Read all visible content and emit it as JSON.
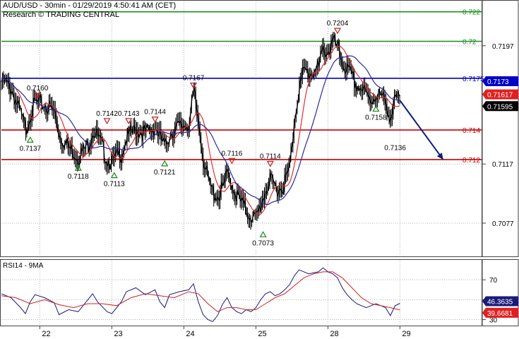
{
  "header": {
    "symbol_line": "AUD/USD - 30min - 01/29/2019 4:50:41 AM (CET)",
    "research_line": "Research © TRADING CENTRAL"
  },
  "chart_data": [
    {
      "type": "candlestick",
      "title": "AUD/USD - 30min - 01/29/2019 4:50:41 AM (CET)",
      "ylim": [
        0.7055,
        0.7227
      ],
      "y_ticks": [
        0.7077,
        0.7117,
        0.7197
      ],
      "x_ticks": [
        {
          "label": "22",
          "t": 0.08
        },
        {
          "label": "23",
          "t": 0.23
        },
        {
          "label": "24",
          "t": 0.38
        },
        {
          "label": "25",
          "t": 0.53
        },
        {
          "label": "28",
          "t": 0.68
        },
        {
          "label": "29",
          "t": 0.83
        }
      ],
      "horizontal_levels": [
        {
          "value": 0.722,
          "label": "0.722",
          "color": "#1e8c1e"
        },
        {
          "value": 0.72,
          "label": "0.72",
          "color": "#1e8c1e"
        },
        {
          "value": 0.7175,
          "label": "0.7175",
          "color": "#0000b4"
        },
        {
          "value": 0.714,
          "label": "0.714",
          "color": "#c80000"
        },
        {
          "value": 0.712,
          "label": "0.712",
          "color": "#c80000"
        }
      ],
      "price_badges": [
        {
          "value": 0.7173,
          "label": "0.7173",
          "color": "#0000c8"
        },
        {
          "value": 0.71617,
          "label": "0.71617",
          "color": "#e02020"
        },
        {
          "value": 0.71595,
          "label": "0.71595",
          "color": "#000000"
        }
      ],
      "close_path": [
        [
          0.0,
          0.7173
        ],
        [
          0.02,
          0.7168
        ],
        [
          0.04,
          0.715
        ],
        [
          0.05,
          0.714
        ],
        [
          0.06,
          0.7152
        ],
        [
          0.07,
          0.7158
        ],
        [
          0.09,
          0.7157
        ],
        [
          0.11,
          0.7152
        ],
        [
          0.12,
          0.7137
        ],
        [
          0.14,
          0.7128
        ],
        [
          0.16,
          0.7122
        ],
        [
          0.18,
          0.713
        ],
        [
          0.19,
          0.714
        ],
        [
          0.2,
          0.7135
        ],
        [
          0.22,
          0.712
        ],
        [
          0.23,
          0.7118
        ],
        [
          0.25,
          0.7125
        ],
        [
          0.26,
          0.7135
        ],
        [
          0.28,
          0.714
        ],
        [
          0.3,
          0.7138
        ],
        [
          0.32,
          0.7142
        ],
        [
          0.33,
          0.7135
        ],
        [
          0.34,
          0.7128
        ],
        [
          0.35,
          0.7138
        ],
        [
          0.37,
          0.7142
        ],
        [
          0.39,
          0.7145
        ],
        [
          0.4,
          0.7165
        ],
        [
          0.41,
          0.7145
        ],
        [
          0.42,
          0.712
        ],
        [
          0.43,
          0.7105
        ],
        [
          0.44,
          0.7098
        ],
        [
          0.45,
          0.7095
        ],
        [
          0.46,
          0.71
        ],
        [
          0.47,
          0.711
        ],
        [
          0.48,
          0.7103
        ],
        [
          0.49,
          0.7095
        ],
        [
          0.5,
          0.709
        ],
        [
          0.51,
          0.7085
        ],
        [
          0.52,
          0.7082
        ],
        [
          0.53,
          0.708
        ],
        [
          0.54,
          0.709
        ],
        [
          0.55,
          0.71
        ],
        [
          0.56,
          0.7105
        ],
        [
          0.57,
          0.7102
        ],
        [
          0.58,
          0.71
        ],
        [
          0.59,
          0.7105
        ],
        [
          0.6,
          0.7115
        ],
        [
          0.61,
          0.715
        ],
        [
          0.62,
          0.717
        ],
        [
          0.63,
          0.718
        ],
        [
          0.64,
          0.7178
        ],
        [
          0.66,
          0.7182
        ],
        [
          0.67,
          0.7195
        ],
        [
          0.68,
          0.7193
        ],
        [
          0.69,
          0.72
        ],
        [
          0.7,
          0.7195
        ],
        [
          0.71,
          0.7185
        ],
        [
          0.72,
          0.718
        ],
        [
          0.73,
          0.7175
        ],
        [
          0.74,
          0.717
        ],
        [
          0.75,
          0.7168
        ],
        [
          0.76,
          0.7162
        ],
        [
          0.77,
          0.716
        ],
        [
          0.78,
          0.7165
        ],
        [
          0.79,
          0.7162
        ],
        [
          0.8,
          0.7158
        ],
        [
          0.81,
          0.7148
        ],
        [
          0.82,
          0.716
        ],
        [
          0.83,
          0.7161
        ]
      ],
      "forecast_arrow": {
        "from": [
          0.83,
          0.716
        ],
        "to": [
          0.92,
          0.712
        ],
        "color": "#0b1f7a"
      },
      "annotations": [
        {
          "label": "0.7160",
          "kind": "high",
          "t": 0.075,
          "v": 0.716
        },
        {
          "label": "0.7142",
          "kind": "high",
          "t": 0.22,
          "v": 0.7143
        },
        {
          "label": "0.7143",
          "kind": "high",
          "t": 0.265,
          "v": 0.7143
        },
        {
          "label": "0.7144",
          "kind": "high",
          "t": 0.32,
          "v": 0.7144
        },
        {
          "label": "0.7167",
          "kind": "high",
          "t": 0.4,
          "v": 0.7167
        },
        {
          "label": "0.7116",
          "kind": "high",
          "t": 0.48,
          "v": 0.7116
        },
        {
          "label": "0.7114",
          "kind": "high",
          "t": 0.56,
          "v": 0.7114
        },
        {
          "label": "0.7204",
          "kind": "high",
          "t": 0.7,
          "v": 0.7204
        },
        {
          "label": "0.7137",
          "kind": "low",
          "t": 0.06,
          "v": 0.7137
        },
        {
          "label": "0.7118",
          "kind": "low",
          "t": 0.16,
          "v": 0.7118
        },
        {
          "label": "0.7113",
          "kind": "low",
          "t": 0.235,
          "v": 0.7113
        },
        {
          "label": "0.7121",
          "kind": "low",
          "t": 0.34,
          "v": 0.7121
        },
        {
          "label": "0.7073",
          "kind": "low",
          "t": 0.545,
          "v": 0.7073
        },
        {
          "label": "0.7158",
          "kind": "low",
          "t": 0.78,
          "v": 0.7158
        },
        {
          "label": "0.7136",
          "kind": "plain",
          "t": 0.82,
          "v": 0.7136
        }
      ]
    },
    {
      "type": "line",
      "title": "RSI14 - 9MA",
      "ylim": [
        24,
        90
      ],
      "y_ticks": [
        30,
        50,
        70
      ],
      "series": [
        {
          "name": "RSI14",
          "color": "#1a1a7a",
          "values": [
            [
              0.0,
              56
            ],
            [
              0.02,
              52
            ],
            [
              0.04,
              42
            ],
            [
              0.05,
              36
            ],
            [
              0.06,
              48
            ],
            [
              0.07,
              55
            ],
            [
              0.09,
              52
            ],
            [
              0.11,
              47
            ],
            [
              0.12,
              35
            ],
            [
              0.14,
              40
            ],
            [
              0.16,
              38
            ],
            [
              0.18,
              50
            ],
            [
              0.19,
              56
            ],
            [
              0.2,
              48
            ],
            [
              0.22,
              38
            ],
            [
              0.23,
              36
            ],
            [
              0.25,
              48
            ],
            [
              0.26,
              58
            ],
            [
              0.28,
              62
            ],
            [
              0.3,
              55
            ],
            [
              0.32,
              60
            ],
            [
              0.33,
              48
            ],
            [
              0.34,
              42
            ],
            [
              0.35,
              55
            ],
            [
              0.37,
              58
            ],
            [
              0.39,
              60
            ],
            [
              0.4,
              66
            ],
            [
              0.41,
              48
            ],
            [
              0.42,
              35
            ],
            [
              0.43,
              30
            ],
            [
              0.44,
              28
            ],
            [
              0.45,
              34
            ],
            [
              0.46,
              45
            ],
            [
              0.47,
              52
            ],
            [
              0.48,
              42
            ],
            [
              0.49,
              38
            ],
            [
              0.5,
              36
            ],
            [
              0.51,
              40
            ],
            [
              0.52,
              38
            ],
            [
              0.53,
              42
            ],
            [
              0.54,
              50
            ],
            [
              0.55,
              56
            ],
            [
              0.56,
              58
            ],
            [
              0.57,
              54
            ],
            [
              0.58,
              56
            ],
            [
              0.59,
              60
            ],
            [
              0.6,
              65
            ],
            [
              0.61,
              74
            ],
            [
              0.62,
              80
            ],
            [
              0.63,
              78
            ],
            [
              0.64,
              76
            ],
            [
              0.66,
              78
            ],
            [
              0.67,
              82
            ],
            [
              0.68,
              78
            ],
            [
              0.69,
              76
            ],
            [
              0.7,
              72
            ],
            [
              0.71,
              62
            ],
            [
              0.72,
              55
            ],
            [
              0.73,
              50
            ],
            [
              0.74,
              46
            ],
            [
              0.75,
              44
            ],
            [
              0.76,
              42
            ],
            [
              0.77,
              44
            ],
            [
              0.78,
              46
            ],
            [
              0.79,
              44
            ],
            [
              0.8,
              42
            ],
            [
              0.81,
              34
            ],
            [
              0.82,
              44
            ],
            [
              0.83,
              46.3635
            ]
          ]
        },
        {
          "name": "9MA",
          "color": "#d42020",
          "values": [
            [
              0.0,
              54
            ],
            [
              0.03,
              52
            ],
            [
              0.06,
              46
            ],
            [
              0.09,
              50
            ],
            [
              0.12,
              45
            ],
            [
              0.15,
              42
            ],
            [
              0.18,
              46
            ],
            [
              0.21,
              46
            ],
            [
              0.24,
              44
            ],
            [
              0.27,
              52
            ],
            [
              0.3,
              56
            ],
            [
              0.33,
              54
            ],
            [
              0.36,
              52
            ],
            [
              0.39,
              58
            ],
            [
              0.41,
              56
            ],
            [
              0.43,
              46
            ],
            [
              0.45,
              38
            ],
            [
              0.47,
              42
            ],
            [
              0.49,
              42
            ],
            [
              0.51,
              40
            ],
            [
              0.53,
              40
            ],
            [
              0.55,
              46
            ],
            [
              0.57,
              52
            ],
            [
              0.59,
              56
            ],
            [
              0.61,
              64
            ],
            [
              0.63,
              72
            ],
            [
              0.65,
              76
            ],
            [
              0.67,
              78
            ],
            [
              0.69,
              78
            ],
            [
              0.71,
              72
            ],
            [
              0.73,
              62
            ],
            [
              0.75,
              52
            ],
            [
              0.77,
              46
            ],
            [
              0.79,
              44
            ],
            [
              0.81,
              42
            ],
            [
              0.83,
              39.6681
            ]
          ]
        }
      ],
      "badges": [
        {
          "value": 46.3635,
          "label": "46.3635",
          "color": "#1a1a7a"
        },
        {
          "value": 39.6681,
          "label": "39.6681",
          "color": "#e02020"
        }
      ]
    }
  ]
}
